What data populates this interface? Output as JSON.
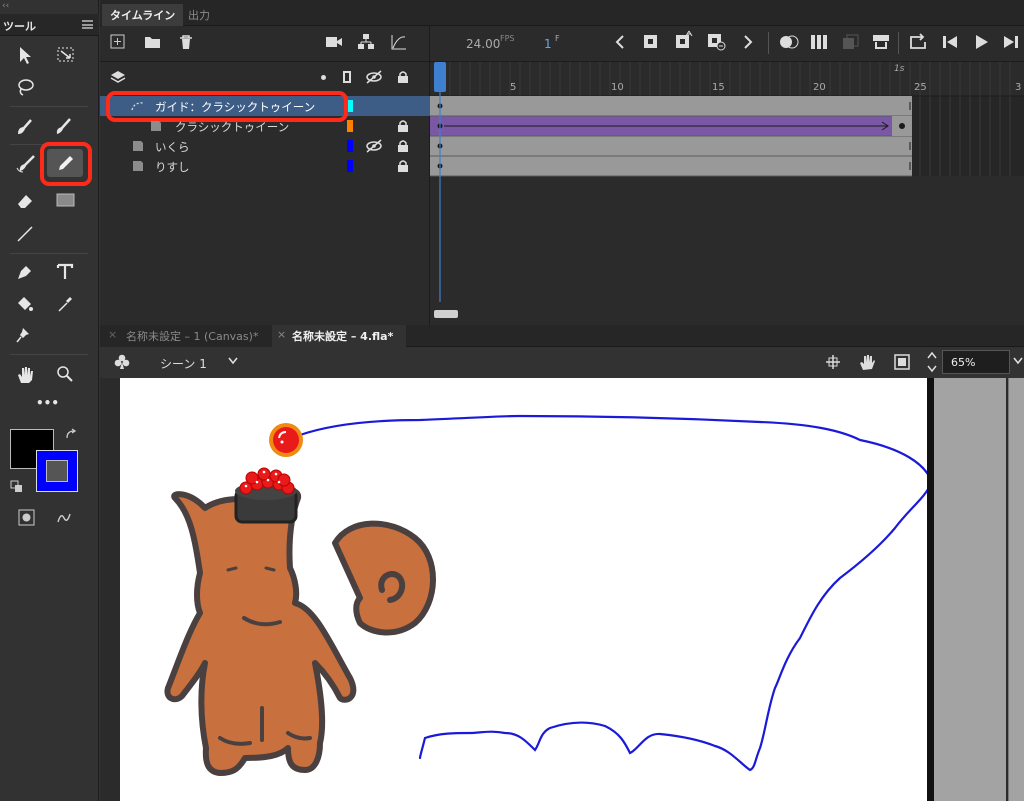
{
  "toolbar": {
    "title": "ツール",
    "collapse": "‹‹",
    "more": "•••"
  },
  "timeline": {
    "tabs": [
      "タイムライン",
      "出力"
    ],
    "fps_value": "24.00",
    "fps_unit": "FPS",
    "frame_value": "1",
    "frame_unit": "F",
    "ruler": [
      "5",
      "10",
      "15",
      "20",
      "25",
      "3"
    ],
    "ruler_second": "1s",
    "layers": [
      {
        "name": "ガイド：クラシックトゥイーン",
        "color": "#00ffff",
        "selected": true
      },
      {
        "name": "クラシックトゥイーン",
        "color": "#ff8000"
      },
      {
        "name": "いくら",
        "color": "#0000ff"
      },
      {
        "name": "りすし",
        "color": "#0000ff"
      }
    ]
  },
  "documents": {
    "tabs": [
      "名称未設定 – 1 (Canvas)*",
      "名称未設定 – 4.fla*"
    ],
    "active": 1
  },
  "scene": {
    "label": "シーン 1",
    "zoom": "65%"
  },
  "colors": {
    "accent": "#3f6fa8",
    "highlight": "#ff2a1a",
    "tween": "#7b58a6",
    "guide_path": "#1a1ad8",
    "fill": "#000000",
    "stroke": "#0000ff"
  }
}
